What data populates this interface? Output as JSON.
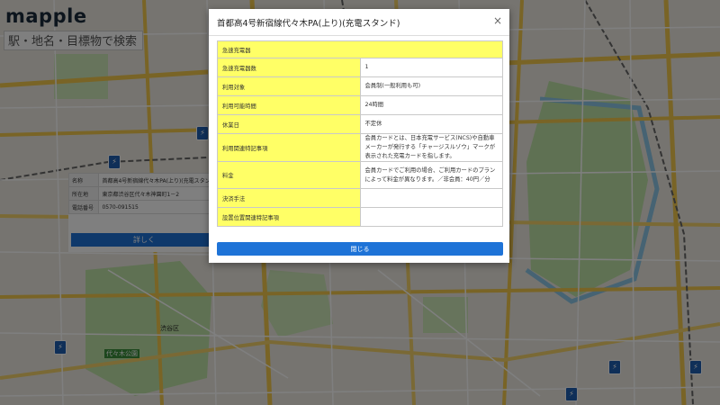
{
  "app": {
    "logo": "mapple",
    "search_placeholder": "駅・地名・目標物で検索"
  },
  "info_card": {
    "rows": [
      {
        "label": "名称",
        "value": "首都高4号新宿線代々木PA(上り)(充電スタンド)"
      },
      {
        "label": "所在地",
        "value": "東京都渋谷区代々木神園町1－2"
      },
      {
        "label": "電話番号",
        "value": "0570-091515"
      }
    ],
    "detail_button": "詳しく"
  },
  "map_labels": {
    "yoyogi_park": "代々木公園",
    "shibuya_ward": "渋谷区"
  },
  "modal": {
    "title": "首都高4号新宿線代々木PA(上り)(充電スタンド)",
    "close_icon": "×",
    "section_header": "急速充電器",
    "rows": [
      {
        "label": "急速充電器数",
        "value": "1"
      },
      {
        "label": "利用対象",
        "value": "会員制(一般利用も可)"
      },
      {
        "label": "利用可能時間",
        "value": "24時間"
      },
      {
        "label": "休業日",
        "value": "不定休"
      },
      {
        "label": "利用関連特記事項",
        "value": "会員カードとは、日本充電サービス(NCS)や自動車メーカーが発行する「チャージスルゾウ」マークが表示された充電カードを指します。"
      },
      {
        "label": "料金",
        "value": "会員カードでご利用の場合、ご利用カードのプランによって料金が異なります。／非会員：40円／分"
      },
      {
        "label": "決済手法",
        "value": ""
      },
      {
        "label": "設置位置関連特記事項",
        "value": ""
      }
    ],
    "close_button": "閉じる"
  },
  "colors": {
    "highlight_yellow": "#ffff66",
    "button_blue": "#1e73d7",
    "overlay": "rgba(0,0,0,0.5)"
  }
}
